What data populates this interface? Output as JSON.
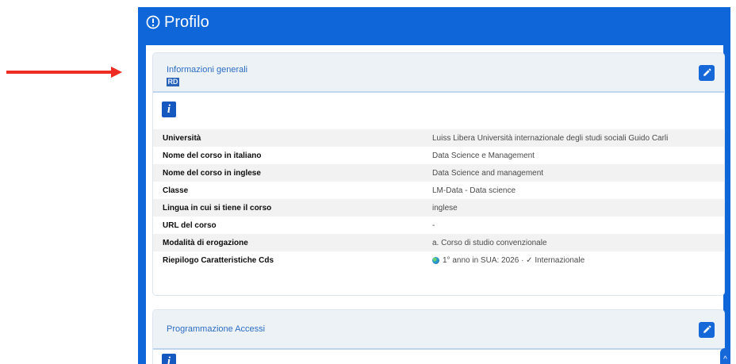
{
  "page": {
    "title": "Profilo"
  },
  "general_info": {
    "title": "Informazioni generali",
    "tag": "RD",
    "rows": [
      {
        "label": "Università",
        "value": "Luiss Libera Università internazionale degli studi sociali Guido Carli"
      },
      {
        "label": "Nome del corso in italiano",
        "value": "Data Science e Management"
      },
      {
        "label": "Nome del corso in inglese",
        "value": "Data Science and management"
      },
      {
        "label": "Classe",
        "value": "LM-Data - Data science"
      },
      {
        "label": "Lingua in cui si tiene il corso",
        "value": "inglese"
      },
      {
        "label": "URL del corso",
        "value": "-"
      },
      {
        "label": "Modalità di erogazione",
        "value": "a. Corso di studio convenzionale"
      },
      {
        "label": "Riepilogo Caratteristiche Cds",
        "value": "1° anno in SUA: 2026 · ✓ Internazionale"
      }
    ]
  },
  "programming_access": {
    "title": "Programmazione Accessi"
  },
  "colors": {
    "arrow": "#ef2c24",
    "panel_blue": "#0f66d8",
    "card_header": "#edf2f7",
    "title_blue": "#2c6cc4",
    "info_blue": "#1558bf",
    "table_stripe": "#f2f2f2"
  },
  "icons": {
    "arrow": "red-arrow-icon",
    "profile": "alert-circle-icon",
    "edit": "pencil-icon",
    "info": "info-icon",
    "globe": "globe-icon"
  }
}
